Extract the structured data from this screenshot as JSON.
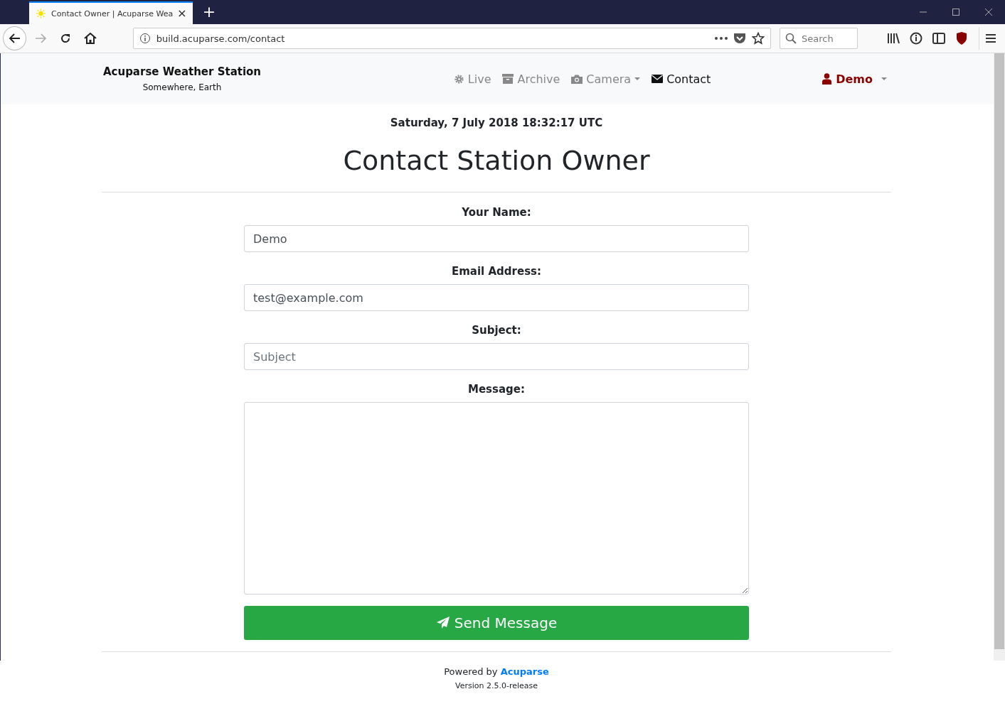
{
  "browser": {
    "tab": {
      "title": "Contact Owner | Acuparse Wea",
      "selected": true
    },
    "new_tab": "+",
    "url": "build.acuparse.com/contact",
    "search": {
      "placeholder": "Search"
    }
  },
  "navbar": {
    "brand": "Acuparse Weather Station",
    "subtitle": "Somewhere, Earth",
    "items": [
      {
        "label": "Live",
        "selected": false,
        "dropdown": false
      },
      {
        "label": "Archive",
        "selected": false,
        "dropdown": false
      },
      {
        "label": "Camera",
        "selected": false,
        "dropdown": true
      },
      {
        "label": "Contact",
        "selected": true,
        "dropdown": false
      }
    ],
    "user": "Demo"
  },
  "page": {
    "datetime": "Saturday, 7 July 2018 18:32:17 UTC",
    "heading": "Contact Station Owner",
    "fields": [
      {
        "kind": "input",
        "label": "Your Name:",
        "value": "Demo"
      },
      {
        "kind": "input",
        "label": "Email Address:",
        "value": "test@example.com"
      },
      {
        "kind": "input",
        "label": "Subject:",
        "placeholder": "Subject"
      },
      {
        "kind": "textarea",
        "label": "Message:"
      }
    ],
    "submit": "Send Message"
  },
  "footer": {
    "powered": "Powered by",
    "link": "Acuparse",
    "version": "Version 2.5.0-release"
  }
}
